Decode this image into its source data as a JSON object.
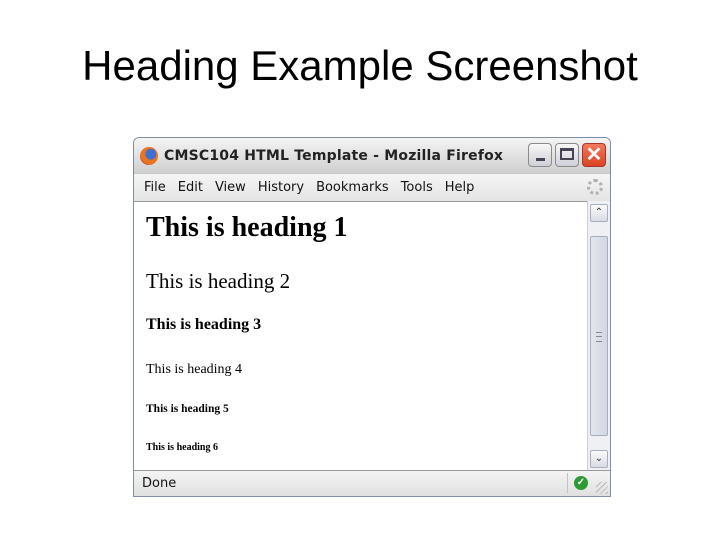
{
  "slide": {
    "title": "Heading Example Screenshot"
  },
  "window": {
    "title": "CMSC104 HTML Template - Mozilla Firefox",
    "controls": {
      "minimize": "minimize",
      "maximize": "maximize",
      "close": "✕"
    }
  },
  "menu": {
    "items": [
      {
        "label": "File"
      },
      {
        "label": "Edit"
      },
      {
        "label": "View"
      },
      {
        "label": "History"
      },
      {
        "label": "Bookmarks"
      },
      {
        "label": "Tools"
      },
      {
        "label": "Help"
      }
    ]
  },
  "content": {
    "headings": [
      "This is heading 1",
      "This is heading 2",
      "This is heading 3",
      "This is heading 4",
      "This is heading 5",
      "This is heading 6"
    ]
  },
  "scrollbar": {
    "up": "⌃",
    "down": "⌄"
  },
  "status": {
    "text": "Done",
    "secure_glyph": "✓"
  }
}
